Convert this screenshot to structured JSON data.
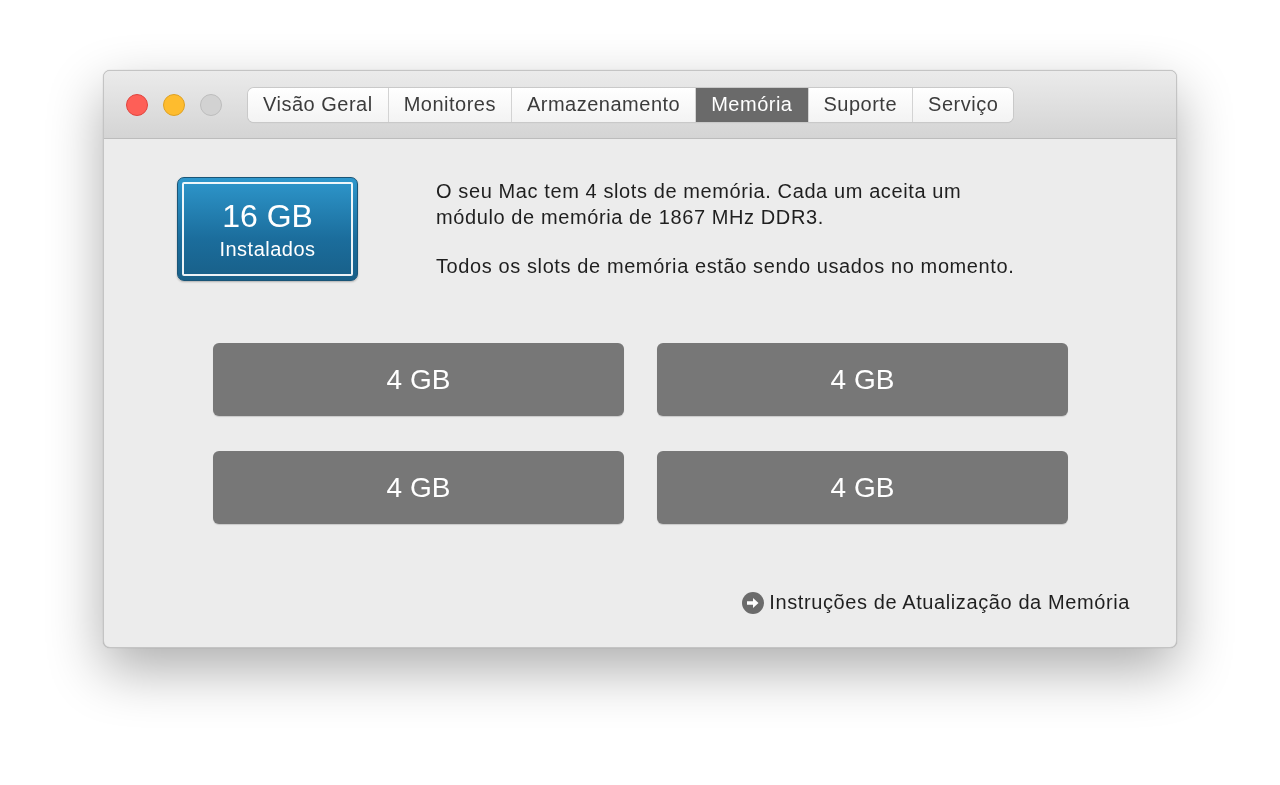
{
  "window": {
    "traffic_lights": [
      {
        "kind": "close",
        "disabled": false
      },
      {
        "kind": "minimize",
        "disabled": false
      },
      {
        "kind": "zoom",
        "disabled": true
      }
    ]
  },
  "tabs": [
    {
      "label": "Visão Geral",
      "selected": false
    },
    {
      "label": "Monitores",
      "selected": false
    },
    {
      "label": "Armazenamento",
      "selected": false
    },
    {
      "label": "Memória",
      "selected": true
    },
    {
      "label": "Suporte",
      "selected": false
    },
    {
      "label": "Serviço",
      "selected": false
    }
  ],
  "installed": {
    "amount": "16 GB",
    "label": "Instalados"
  },
  "description": [
    "O seu Mac tem 4 slots de memória. Cada um aceita um módulo de memória de 1867 MHz DDR3.",
    "Todos os slots de memória estão sendo usados no momento."
  ],
  "slots": [
    {
      "label": "4 GB"
    },
    {
      "label": "4 GB"
    },
    {
      "label": "4 GB"
    },
    {
      "label": "4 GB"
    }
  ],
  "link": {
    "label": "Instruções de Atualização da Memória"
  }
}
